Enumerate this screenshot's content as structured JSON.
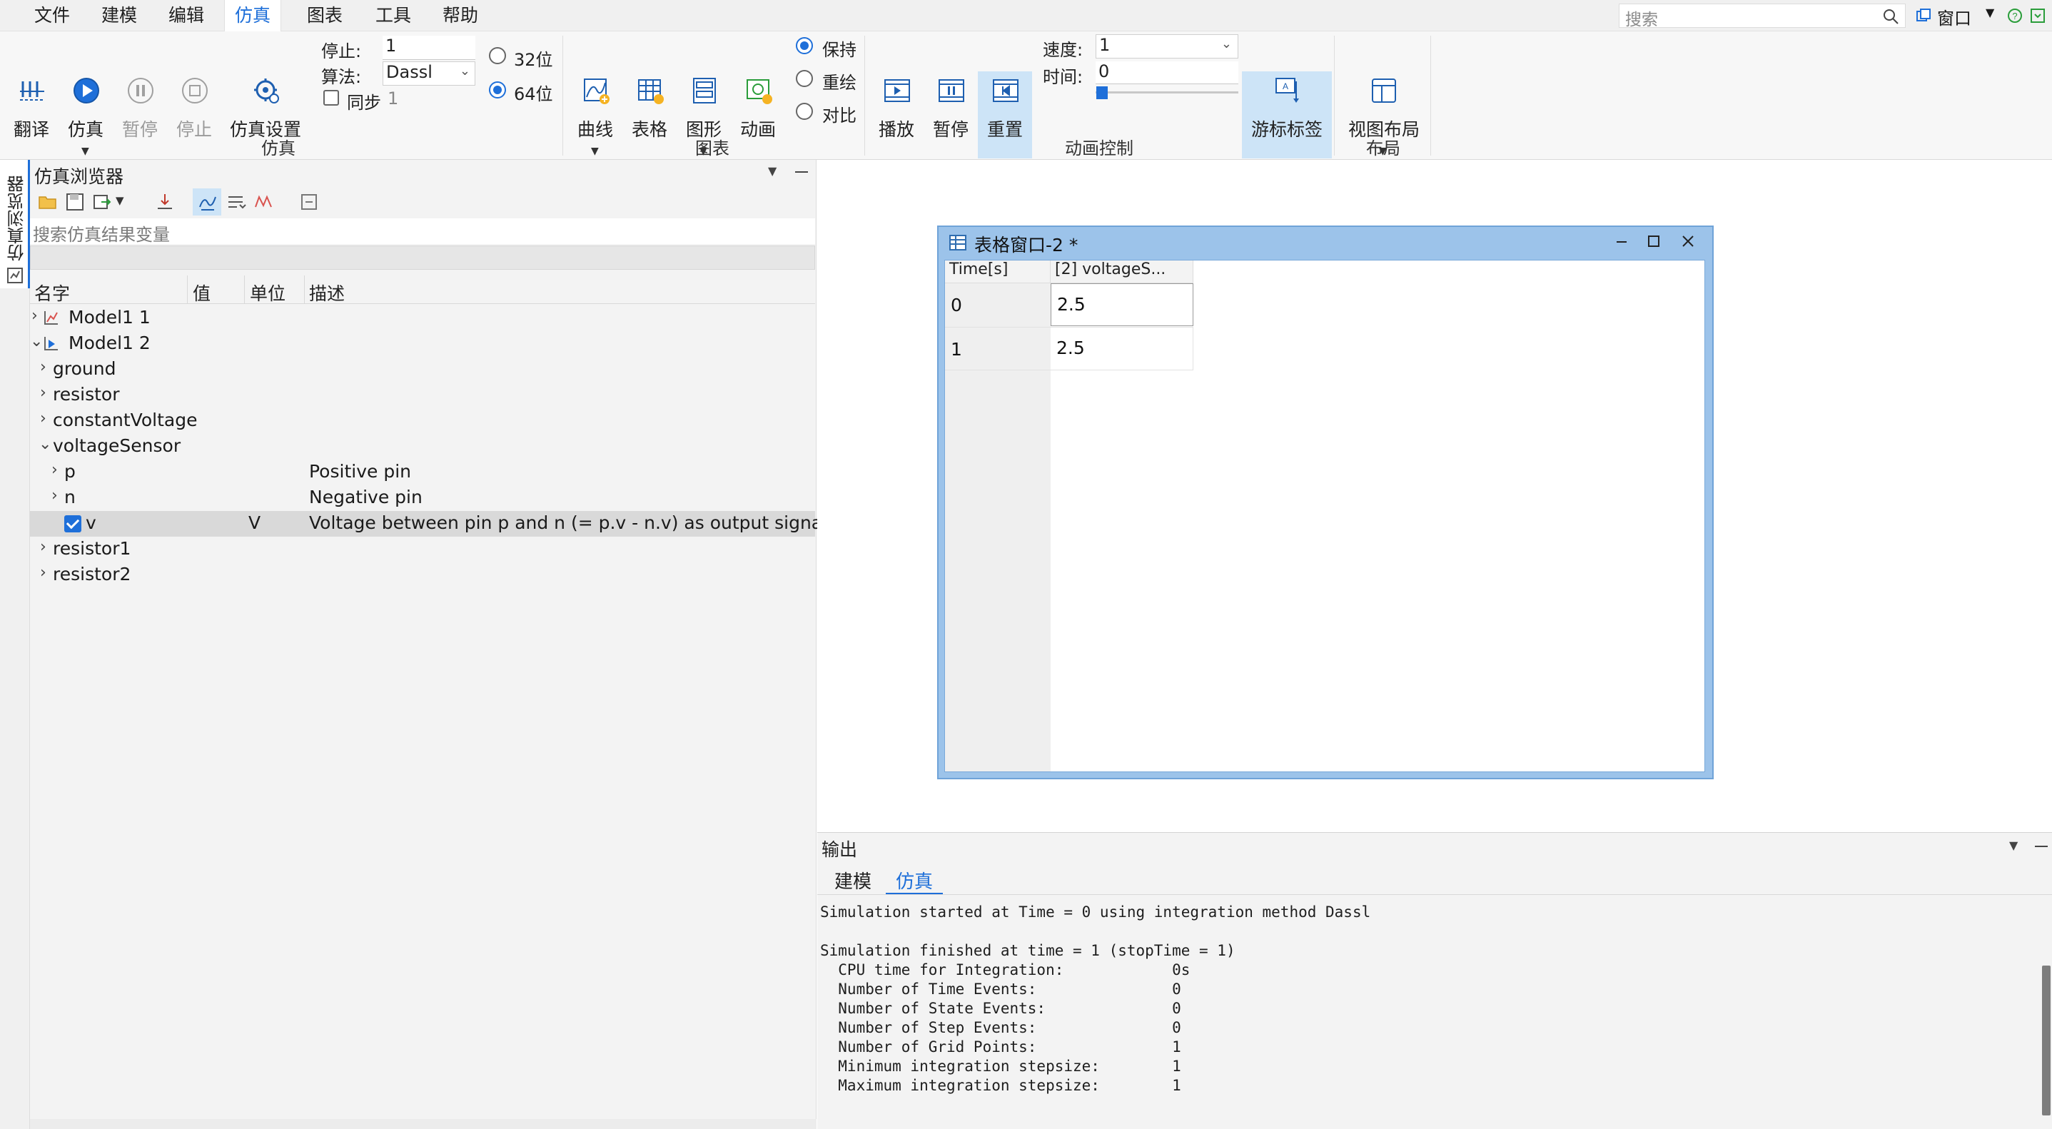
{
  "menu": {
    "items": [
      "文件",
      "建模",
      "编辑",
      "仿真",
      "图表",
      "工具",
      "帮助"
    ],
    "active": "仿真",
    "search_placeholder": "搜索",
    "window_label": "窗口"
  },
  "ribbon": {
    "sim_buttons": {
      "translate": "翻译",
      "simulate": "仿真",
      "pause": "暂停",
      "stop": "停止",
      "settings": "仿真设置"
    },
    "stop_label": "停止:",
    "stop_value": "1",
    "algo_label": "算法:",
    "algo_value": "Dassl",
    "sync_label": "同步",
    "sync_value": "1",
    "bits": {
      "b32": "32位",
      "b64": "64位",
      "selected": "64位"
    },
    "sim_group": "仿真",
    "chart_buttons": {
      "curve": "曲线",
      "table": "表格",
      "graphic": "图形",
      "animation": "动画"
    },
    "chart_modes": {
      "keep": "保持",
      "redraw": "重绘",
      "compare": "对比",
      "selected": "保持"
    },
    "chart_group": "图表",
    "anim_buttons": {
      "play": "播放",
      "pause": "暂停",
      "reset": "重置"
    },
    "speed_label": "速度:",
    "speed_value": "1",
    "time_label": "时间:",
    "time_value": "0",
    "cursor_label": "游标标签",
    "anim_group": "动画控制",
    "layout_button": "视图布局",
    "layout_group": "布局"
  },
  "browser": {
    "side_tab": "仿真浏览器",
    "title": "仿真浏览器",
    "search_placeholder": "搜索仿真结果变量",
    "columns": [
      "名字",
      "值",
      "单位",
      "描述"
    ],
    "rows": [
      {
        "name": "Model1 1",
        "arrow": "›",
        "unit": "",
        "desc": ""
      },
      {
        "name": "Model1 2",
        "arrow": "⌄",
        "unit": "",
        "desc": ""
      },
      {
        "name": "ground",
        "arrow": "›",
        "unit": "",
        "desc": ""
      },
      {
        "name": "resistor",
        "arrow": "›",
        "unit": "",
        "desc": ""
      },
      {
        "name": "constantVoltage",
        "arrow": "›",
        "unit": "",
        "desc": ""
      },
      {
        "name": "voltageSensor",
        "arrow": "⌄",
        "unit": "",
        "desc": ""
      },
      {
        "name": "p",
        "arrow": "›",
        "unit": "",
        "desc": "Positive pin"
      },
      {
        "name": "n",
        "arrow": "›",
        "unit": "",
        "desc": "Negative pin"
      },
      {
        "name": "v",
        "arrow": "",
        "unit": "V",
        "desc": "Voltage between pin p and n (= p.v - n.v) as output signal"
      },
      {
        "name": "resistor1",
        "arrow": "›",
        "unit": "",
        "desc": ""
      },
      {
        "name": "resistor2",
        "arrow": "›",
        "unit": "",
        "desc": ""
      }
    ]
  },
  "table_window": {
    "title": "表格窗口-2 *",
    "headers": [
      "Time[s]",
      "[2] voltageS..."
    ],
    "rows": [
      {
        "time": "0",
        "value": "2.5"
      },
      {
        "time": "1",
        "value": "2.5"
      }
    ]
  },
  "output": {
    "title": "输出",
    "tabs": [
      "建模",
      "仿真"
    ],
    "active_tab": "仿真",
    "log": "Simulation started at Time = 0 using integration method Dassl\n\nSimulation finished at time = 1 (stopTime = 1)\n  CPU time for Integration:            0s\n  Number of Time Events:               0\n  Number of State Events:              0\n  Number of Step Events:               0\n  Number of Grid Points:               1\n  Minimum integration stepsize:        1\n  Maximum integration stepsize:        1"
  },
  "colors": {
    "accent": "#1e6fd9",
    "table_window_frame": "#9cc3ea",
    "highlight_button": "#cde4f7"
  }
}
